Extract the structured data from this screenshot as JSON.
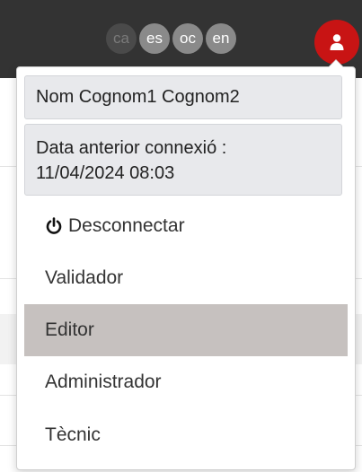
{
  "languages": [
    {
      "code": "ca",
      "current": true
    },
    {
      "code": "es",
      "current": false
    },
    {
      "code": "oc",
      "current": false
    },
    {
      "code": "en",
      "current": false
    }
  ],
  "user_menu": {
    "user_name": "Nom Cognom1 Cognom2",
    "last_login_label": "Data anterior connexió :",
    "last_login_value": "11/04/2024 08:03",
    "logout_label": "Desconnectar",
    "roles": [
      {
        "label": "Validador",
        "active": false
      },
      {
        "label": "Editor",
        "active": true
      },
      {
        "label": "Administrador",
        "active": false
      },
      {
        "label": "Tècnic",
        "active": false
      }
    ]
  },
  "colors": {
    "header_bg": "#333333",
    "user_button": "#c81414",
    "active_role_bg": "#c6c1bf",
    "info_box_bg": "#e8e9ec"
  },
  "icons": {
    "user_button": "user-icon",
    "logout": "power-icon"
  }
}
